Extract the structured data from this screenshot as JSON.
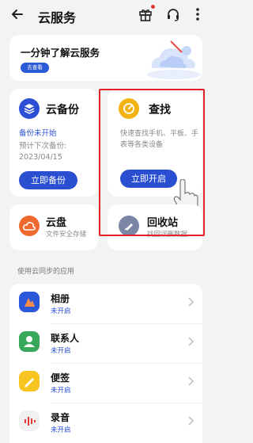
{
  "header": {
    "title": "云服务"
  },
  "banner": {
    "title": "一分钟了解云服务",
    "button_label": "去查看"
  },
  "backup_card": {
    "title": "云备份",
    "status": "备份未开始",
    "next_label": "预计下次备份:",
    "next_date": "2023/04/15",
    "button_label": "立即备份"
  },
  "find_card": {
    "title": "查找",
    "description": "快速查找手机、平板、手表等各类设备",
    "button_label": "立即开启"
  },
  "drive_card": {
    "title": "云盘",
    "subtitle": "文件安全存储"
  },
  "recycle_card": {
    "title": "回收站",
    "subtitle": "找回误删数据"
  },
  "sync_section": {
    "label": "使用云同步的应用",
    "items": [
      {
        "title": "相册",
        "status": "未开启"
      },
      {
        "title": "联系人",
        "status": "未开启"
      },
      {
        "title": "便签",
        "status": "未开启"
      },
      {
        "title": "录音",
        "status": "未开启"
      }
    ]
  },
  "colors": {
    "accent_blue": "#2a4fd1",
    "highlight_red": "#e5212b",
    "backup_icon": "#2d4fd6",
    "find_icon": "#f2b313",
    "drive_icon": "#ef6a2f",
    "recycle_icon": "#7a86a3"
  }
}
